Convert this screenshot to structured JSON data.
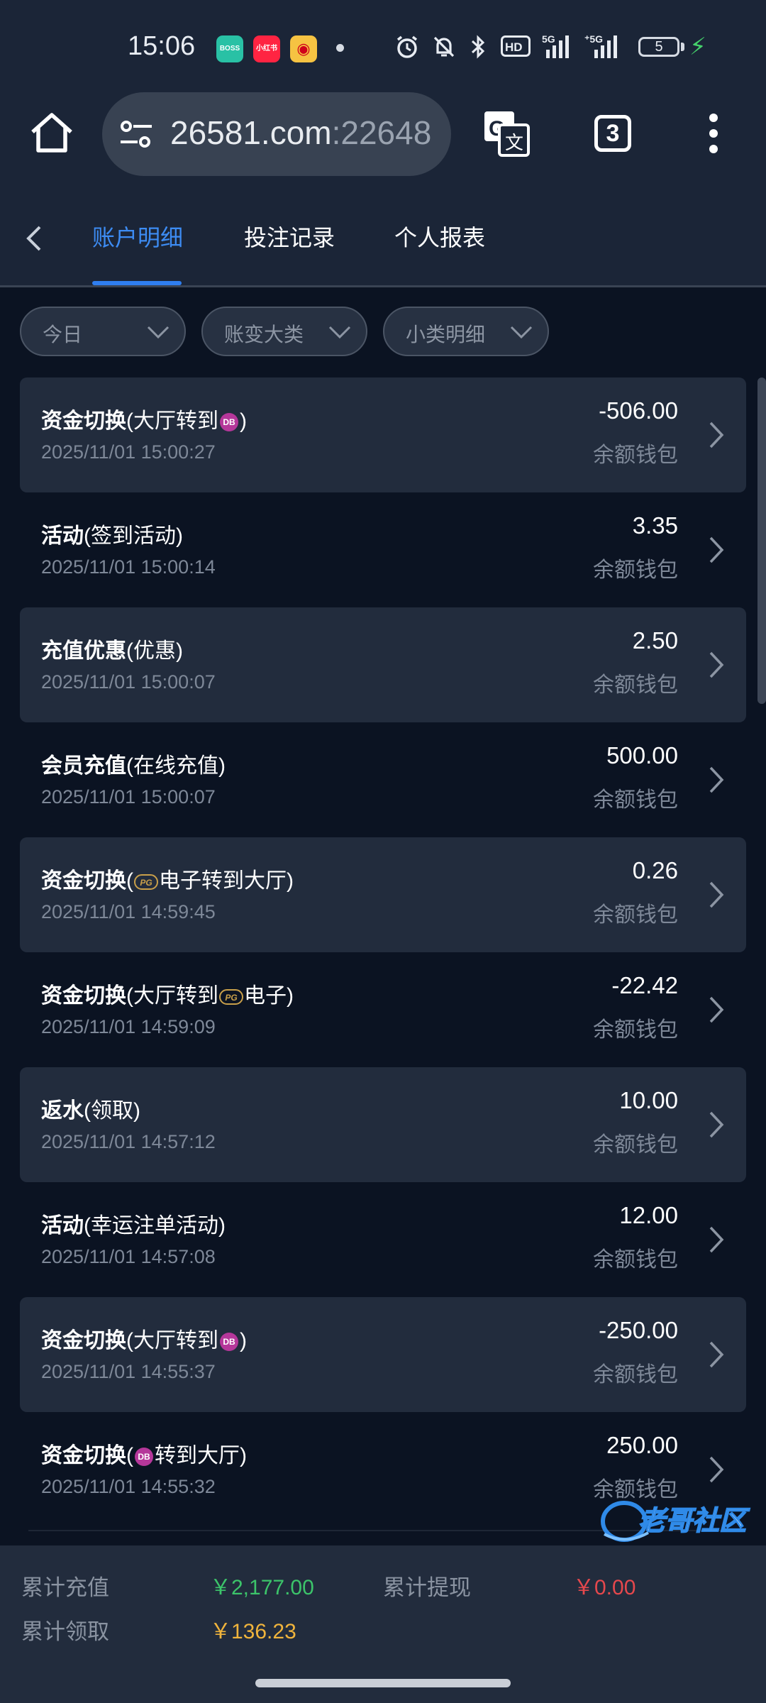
{
  "status_bar": {
    "time": "15:06",
    "apps": [
      "BOSS直聘",
      "小红书",
      "微博"
    ],
    "network": "5G",
    "battery": "5",
    "icons": [
      "alarm-icon",
      "mute-icon",
      "bluetooth-icon",
      "hd-icon",
      "signal-icon",
      "battery-icon"
    ]
  },
  "browser": {
    "url_host": "26581.com",
    "url_port": ":22648",
    "tab_count": "3"
  },
  "nav": {
    "tabs": [
      {
        "label": "账户明细",
        "active": true
      },
      {
        "label": "投注记录",
        "active": false
      },
      {
        "label": "个人报表",
        "active": false
      }
    ]
  },
  "filters": [
    {
      "label": "今日"
    },
    {
      "label": "账变大类"
    },
    {
      "label": "小类明细"
    }
  ],
  "records": [
    {
      "title": "资金切换",
      "sub_pre": "(大厅转到",
      "sub_post": ")",
      "icon": "game",
      "time": "2025/11/01 15:00:27",
      "amount": "-506.00",
      "wallet": "余额钱包"
    },
    {
      "title": "活动",
      "sub_pre": "(签到活动)",
      "sub_post": "",
      "icon": "",
      "time": "2025/11/01 15:00:14",
      "amount": "3.35",
      "wallet": "余额钱包"
    },
    {
      "title": "充值优惠",
      "sub_pre": "(优惠)",
      "sub_post": "",
      "icon": "",
      "time": "2025/11/01 15:00:07",
      "amount": "2.50",
      "wallet": "余额钱包"
    },
    {
      "title": "会员充值",
      "sub_pre": "(在线充值)",
      "sub_post": "",
      "icon": "",
      "time": "2025/11/01 15:00:07",
      "amount": "500.00",
      "wallet": "余额钱包"
    },
    {
      "title": "资金切换",
      "sub_pre": "(",
      "sub_post": "电子转到大厅)",
      "icon": "pg",
      "time": "2025/11/01 14:59:45",
      "amount": "0.26",
      "wallet": "余额钱包"
    },
    {
      "title": "资金切换",
      "sub_pre": "(大厅转到",
      "sub_post": "电子)",
      "icon": "pg",
      "time": "2025/11/01 14:59:09",
      "amount": "-22.42",
      "wallet": "余额钱包"
    },
    {
      "title": "返水",
      "sub_pre": "(领取)",
      "sub_post": "",
      "icon": "",
      "time": "2025/11/01 14:57:12",
      "amount": "10.00",
      "wallet": "余额钱包"
    },
    {
      "title": "活动",
      "sub_pre": "(幸运注单活动)",
      "sub_post": "",
      "icon": "",
      "time": "2025/11/01 14:57:08",
      "amount": "12.00",
      "wallet": "余额钱包"
    },
    {
      "title": "资金切换",
      "sub_pre": "(大厅转到",
      "sub_post": ")",
      "icon": "game",
      "time": "2025/11/01 14:55:37",
      "amount": "-250.00",
      "wallet": "余额钱包"
    },
    {
      "title": "资金切换",
      "sub_pre": "(",
      "sub_post": "转到大厅)",
      "icon": "game",
      "time": "2025/11/01 14:55:32",
      "amount": "250.00",
      "wallet": "余额钱包"
    }
  ],
  "summary": {
    "recharge_label": "累计充值",
    "recharge_value": "￥2,177.00",
    "withdraw_label": "累计提现",
    "withdraw_value": "￥0.00",
    "claim_label": "累计领取",
    "claim_value": "￥136.23"
  },
  "watermark": "老哥社区",
  "colors": {
    "accent": "#3d8cf3",
    "positive": "#3cc46a",
    "negative": "#e5484d",
    "gold": "#f0b43c"
  }
}
